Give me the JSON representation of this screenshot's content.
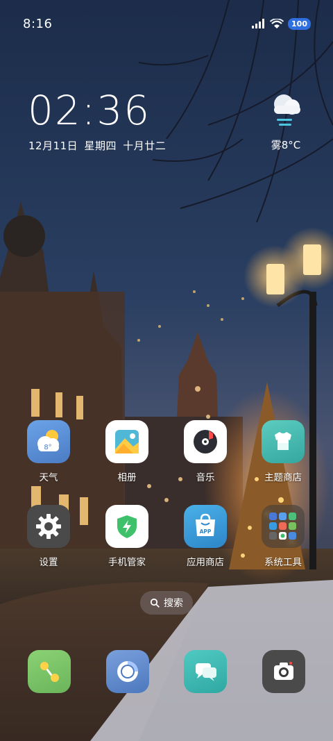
{
  "status_bar": {
    "time": "8:16",
    "battery": "100",
    "icons": [
      "signal-icon",
      "wifi-icon",
      "battery-icon"
    ]
  },
  "clock_widget": {
    "time": "02:36",
    "date": "12月11日 星期四 十月廿二"
  },
  "weather_widget": {
    "icon": "cloud-icon",
    "text": "雾8°C"
  },
  "apps": [
    {
      "label": "天气",
      "icon": "weather-app-icon",
      "color": "#5a8fd6",
      "badge": "8°"
    },
    {
      "label": "相册",
      "icon": "gallery-icon",
      "color": "#ffffff"
    },
    {
      "label": "音乐",
      "icon": "music-icon",
      "color": "#ffffff"
    },
    {
      "label": "主题商店",
      "icon": "theme-store-icon",
      "color": "#4bbab0"
    },
    {
      "label": "设置",
      "icon": "settings-icon",
      "color": "#4a4a4a"
    },
    {
      "label": "手机管家",
      "icon": "security-icon",
      "color": "#ffffff"
    },
    {
      "label": "应用商店",
      "icon": "app-store-icon",
      "color": "#3a9ad9",
      "badge": "APP"
    },
    {
      "label": "系统工具",
      "icon": "folder-icon",
      "color": "rgba(60,60,60,0.55)"
    }
  ],
  "search": {
    "label": "搜索",
    "icon": "search-icon"
  },
  "dock": [
    {
      "icon": "phone-icon",
      "color": "#7ec36a"
    },
    {
      "icon": "browser-icon",
      "color": "#5a86c8"
    },
    {
      "icon": "messages-icon",
      "color": "#3fbcb6"
    },
    {
      "icon": "camera-icon",
      "color": "#4a4a4a"
    }
  ]
}
